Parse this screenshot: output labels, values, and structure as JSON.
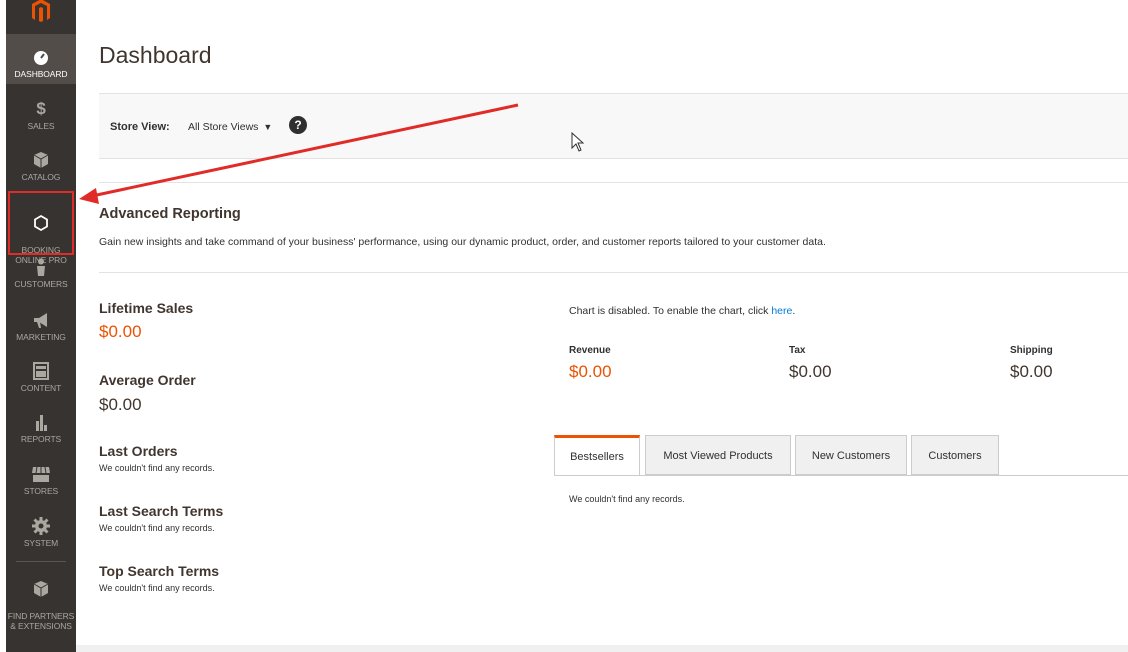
{
  "sidebar": {
    "items": [
      {
        "label": "DASHBOARD",
        "icon": "dashboard-icon"
      },
      {
        "label": "SALES",
        "icon": "dollar-icon"
      },
      {
        "label": "CATALOG",
        "icon": "box-icon"
      },
      {
        "label": "BOOKING\nONLINE PRO",
        "icon": "hexagon-icon"
      },
      {
        "label": "CUSTOMERS",
        "icon": "person-icon"
      },
      {
        "label": "MARKETING",
        "icon": "megaphone-icon"
      },
      {
        "label": "CONTENT",
        "icon": "layout-icon"
      },
      {
        "label": "REPORTS",
        "icon": "bar-chart-icon"
      },
      {
        "label": "STORES",
        "icon": "store-icon"
      },
      {
        "label": "SYSTEM",
        "icon": "gear-icon"
      },
      {
        "label": "FIND PARTNERS\n& EXTENSIONS",
        "icon": "partners-icon"
      }
    ],
    "brand_color": "#eb5202"
  },
  "page": {
    "title": "Dashboard"
  },
  "store_switcher": {
    "label": "Store View:",
    "selected": "All Store Views",
    "help": "?"
  },
  "advanced_reporting": {
    "title": "Advanced Reporting",
    "description": "Gain new insights and take command of your business' performance, using our dynamic product, order, and customer reports tailored to your customer data."
  },
  "stats": {
    "lifetime_sales_label": "Lifetime Sales",
    "lifetime_sales_value": "$0.00",
    "average_order_label": "Average Order",
    "average_order_value": "$0.00",
    "last_orders_label": "Last Orders",
    "last_orders_empty": "We couldn't find any records.",
    "last_search_label": "Last Search Terms",
    "last_search_empty": "We couldn't find any records.",
    "top_search_label": "Top Search Terms",
    "top_search_empty": "We couldn't find any records."
  },
  "chart": {
    "disabled_text": "Chart is disabled. To enable the chart, click ",
    "link_text": "here",
    "link_suffix": ".",
    "revenue_label": "Revenue",
    "revenue_value": "$0.00",
    "tax_label": "Tax",
    "tax_value": "$0.00",
    "shipping_label": "Shipping",
    "shipping_value": "$0.00"
  },
  "tabs": {
    "items": [
      "Bestsellers",
      "Most Viewed Products",
      "New Customers",
      "Customers"
    ],
    "active": "Bestsellers",
    "empty": "We couldn't find any records."
  },
  "colors": {
    "accent": "#eb5202",
    "annotation": "#e02b27",
    "link": "#007bdb"
  }
}
